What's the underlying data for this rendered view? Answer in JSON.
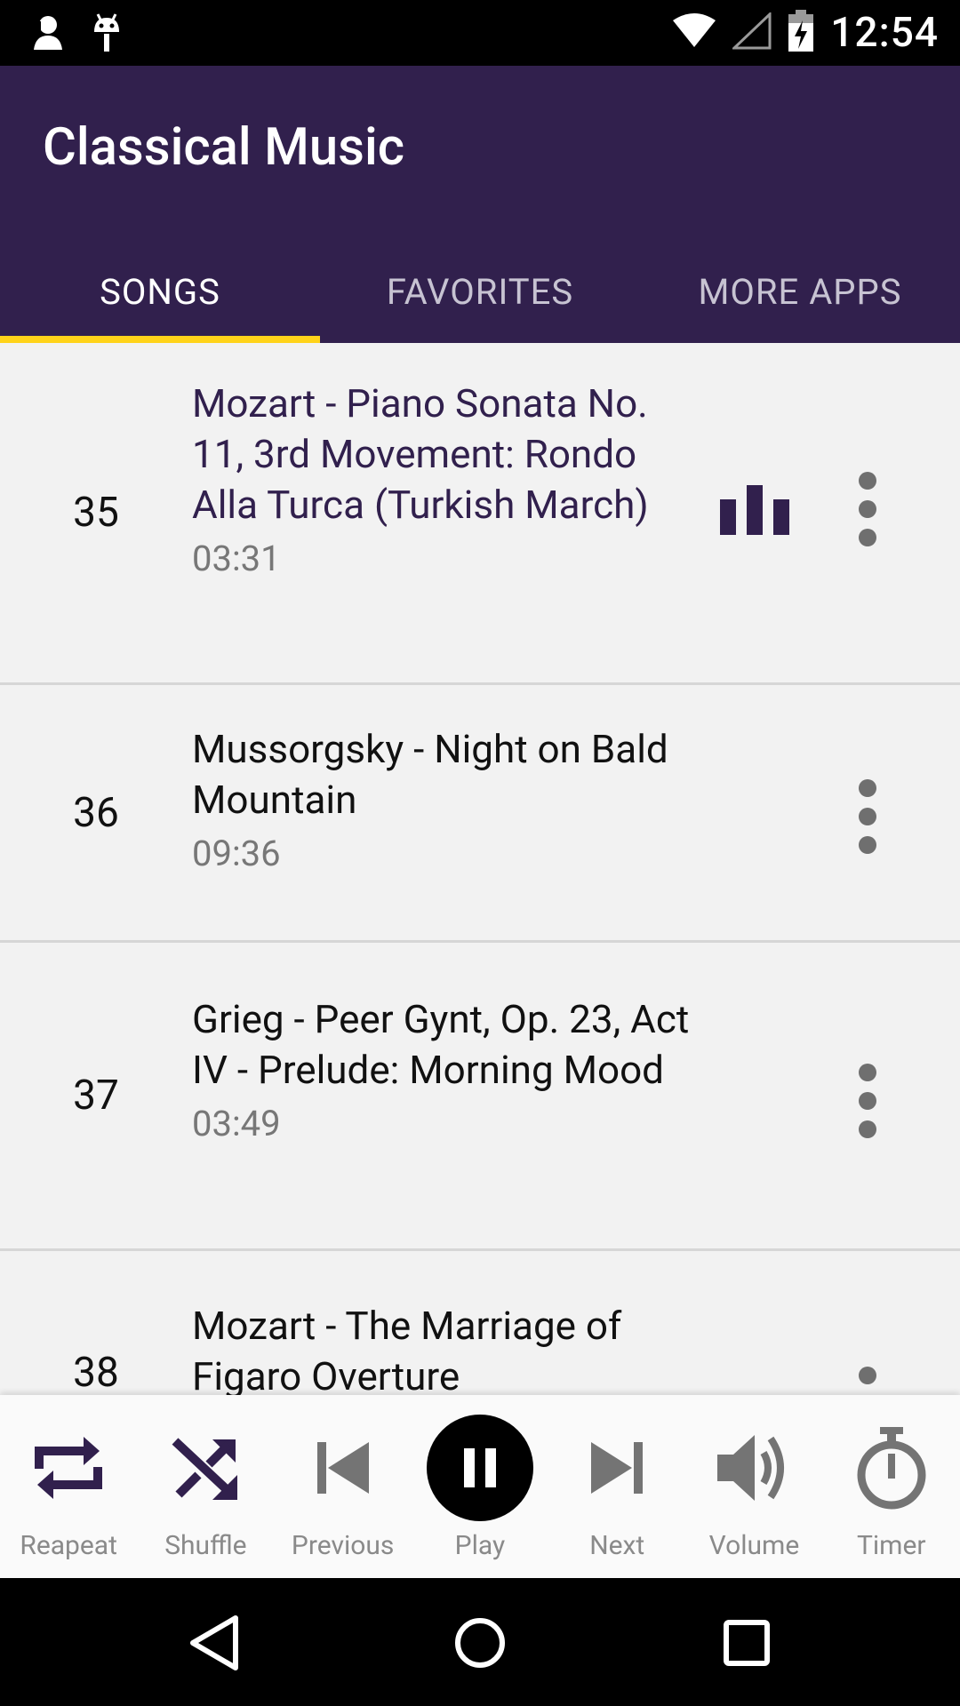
{
  "status_bar": {
    "time": "12:54",
    "icons": [
      "notification-person-icon",
      "android-debug-icon",
      "wifi-icon",
      "signal-icon",
      "battery-charging-icon"
    ]
  },
  "app": {
    "title": "Classical Music",
    "colors": {
      "primary": "#31204d",
      "accent": "#ffd31a",
      "playing_text": "#31204d"
    }
  },
  "tabs": [
    {
      "label": "SONGS",
      "active": true
    },
    {
      "label": "FAVORITES",
      "active": false
    },
    {
      "label": "MORE APPS",
      "active": false
    }
  ],
  "songs": [
    {
      "number": "35",
      "title": "Mozart - Piano Sonata No. 11, 3rd Movement: Rondo Alla Turca (Turkish March)",
      "duration": "03:31",
      "playing": true
    },
    {
      "number": "36",
      "title": "Mussorgsky - Night on Bald Mountain",
      "duration": "09:36",
      "playing": false
    },
    {
      "number": "37",
      "title": "Grieg - Peer Gynt, Op. 23, Act IV - Prelude: Morning Mood",
      "duration": "03:49",
      "playing": false
    },
    {
      "number": "38",
      "title": "Mozart - The Marriage of Figaro Overture",
      "duration": "",
      "playing": false
    }
  ],
  "player": {
    "repeat": "Reapeat",
    "shuffle": "Shuffle",
    "previous": "Previous",
    "play": "Play",
    "next": "Next",
    "volume": "Volume",
    "timer": "Timer"
  },
  "nav_bar": [
    "back-icon",
    "home-icon",
    "recents-icon"
  ]
}
